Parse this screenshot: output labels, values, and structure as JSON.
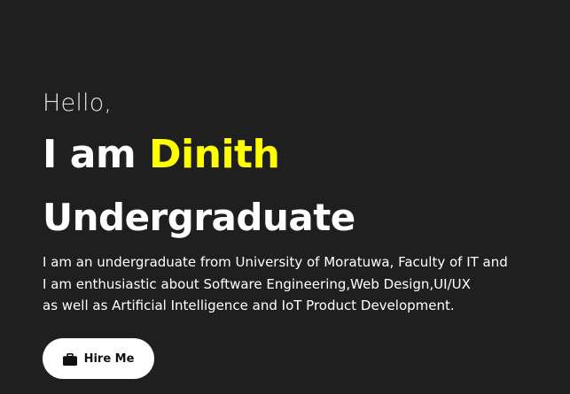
{
  "hero": {
    "greeting": "Hello,",
    "intro_prefix": "I am ",
    "name": "Dinith",
    "role": "Undergraduate",
    "description": [
      "I am an undergraduate from University of Moratuwa, Faculty of IT and",
      "I am enthusiastic about Software Engineering,Web Design,UI/UX",
      "as well as Artificial Intelligence and IoT Product Development."
    ],
    "cta": {
      "label": "Hire Me",
      "icon": "briefcase-icon"
    }
  },
  "colors": {
    "background": "#1f1f1f",
    "accent": "#ffff00",
    "text": "#ffffff",
    "button_bg": "#ffffff"
  }
}
